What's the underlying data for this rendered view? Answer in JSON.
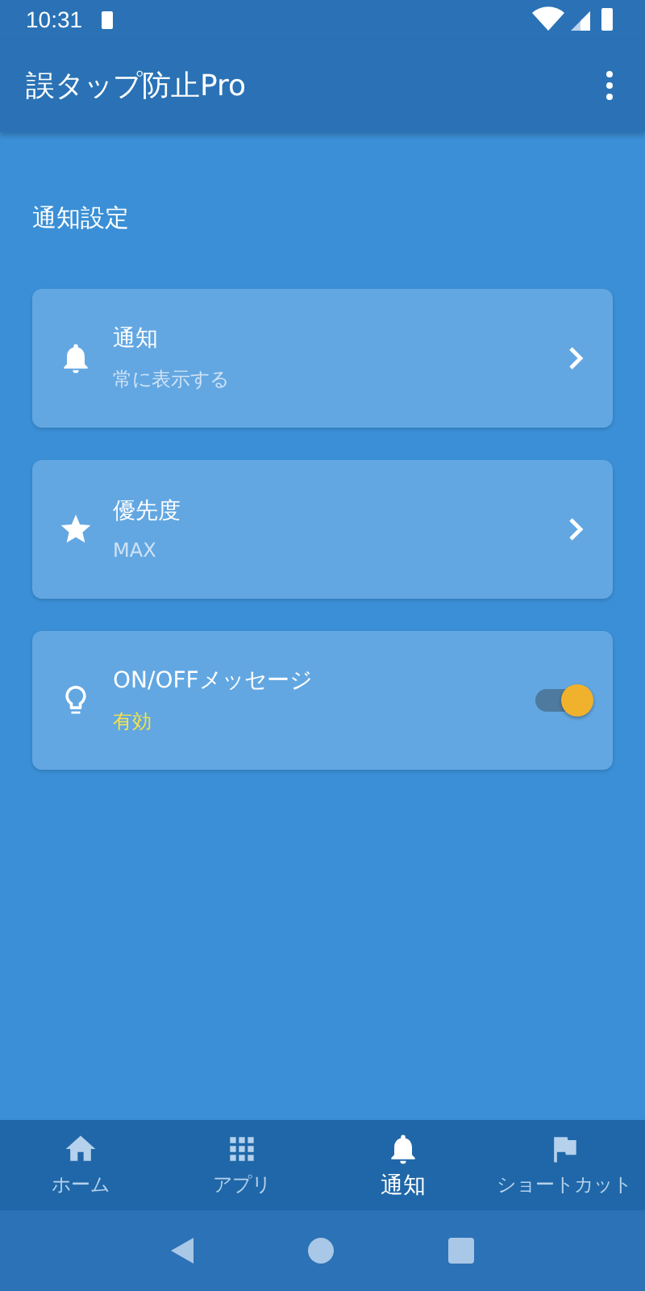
{
  "status_bar": {
    "time": "10:31"
  },
  "app_bar": {
    "title": "誤タップ防止Pro"
  },
  "section": {
    "title": "通知設定"
  },
  "settings": [
    {
      "kind": "link",
      "title": "通知",
      "value": "常に表示する"
    },
    {
      "kind": "link",
      "title": "優先度",
      "value": "MAX"
    },
    {
      "kind": "toggle",
      "title": "ON/OFFメッセージ",
      "value": "有効",
      "on": true
    }
  ],
  "bottom_nav": [
    {
      "label": "ホーム",
      "selected": false
    },
    {
      "label": "アプリ",
      "selected": false
    },
    {
      "label": "通知",
      "selected": true
    },
    {
      "label": "ショートカット",
      "selected": false
    }
  ]
}
